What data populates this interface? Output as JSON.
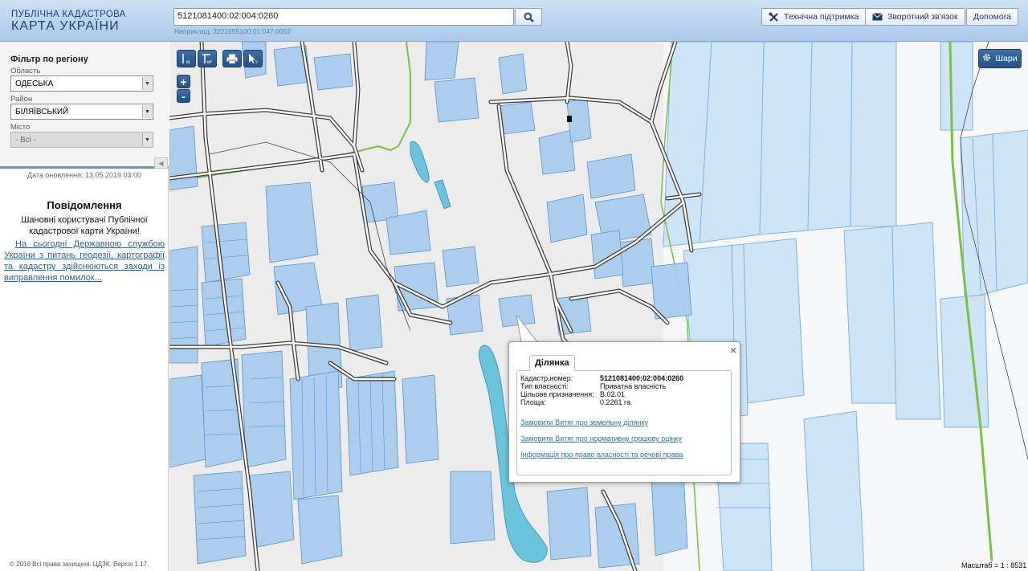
{
  "header": {
    "logo_line1": "ПУБЛІЧНА КАДАСТРОВА",
    "logo_line2": "КАРТА УКРАЇНИ",
    "search_value": "5121081400:02:004:0260",
    "search_hint": "Наприклад, 3221655100:01:047:0052",
    "buttons": {
      "support": "Технічна підтримка",
      "feedback": "Зворотний зв'язок",
      "help": "Допомога"
    }
  },
  "sidebar": {
    "filter_title": "Фільтр по регіону",
    "oblast_label": "Область",
    "oblast_value": "ОДЕСЬКА",
    "raion_label": "Район",
    "raion_value": "БІЛЯЇВСЬКИЙ",
    "misto_label": "Місто",
    "misto_value": "- Всі -",
    "update_date": "Дата оновлення: 13.05.2019 03:00",
    "notice_title": "Повідомлення",
    "notice_greeting": "Шановні користувачі Публічної кадастрової карти України!",
    "notice_link": "На сьогодні Державною службою України з питань геодезії, картографії та кадастру здійснюються заходи із виправлення помилок...",
    "copyright": "© 2016 Всі права захищені. ЦДЗК. Версія 1.17."
  },
  "map": {
    "layers_label": "Шари",
    "scale_text": "Масштаб = 1 : 8531",
    "zoom_in": "+",
    "zoom_out": "-",
    "tools": {
      "length_icon": "measure-length-icon",
      "area_icon": "measure-area-icon",
      "print_icon": "print-icon",
      "identify_icon": "identify-icon"
    }
  },
  "popup": {
    "tab_label": "Ділянка",
    "close": "×",
    "rows": [
      {
        "key": "Кадастр.номер:",
        "value": "5121081400:02:004:0260"
      },
      {
        "key": "Тип власності:",
        "value": "Приватна власність"
      },
      {
        "key": "Цільове призначення:",
        "value": "В.02.01"
      },
      {
        "key": "Площа:",
        "value": "0.2261 га"
      }
    ],
    "links": [
      "Замовити Витяг про земельну ділянку",
      "Замовити Витяг про нормативну грошову оцінку",
      "Інформація про право власності та речові права"
    ]
  },
  "colors": {
    "parcel_fill": "#a8cdef",
    "parcel_stroke": "#4d8fd0",
    "water": "#6bc4de",
    "road": "#3a3a3a",
    "boundary_green": "#7ac143",
    "toolbar_blue": "#2f5f98"
  }
}
